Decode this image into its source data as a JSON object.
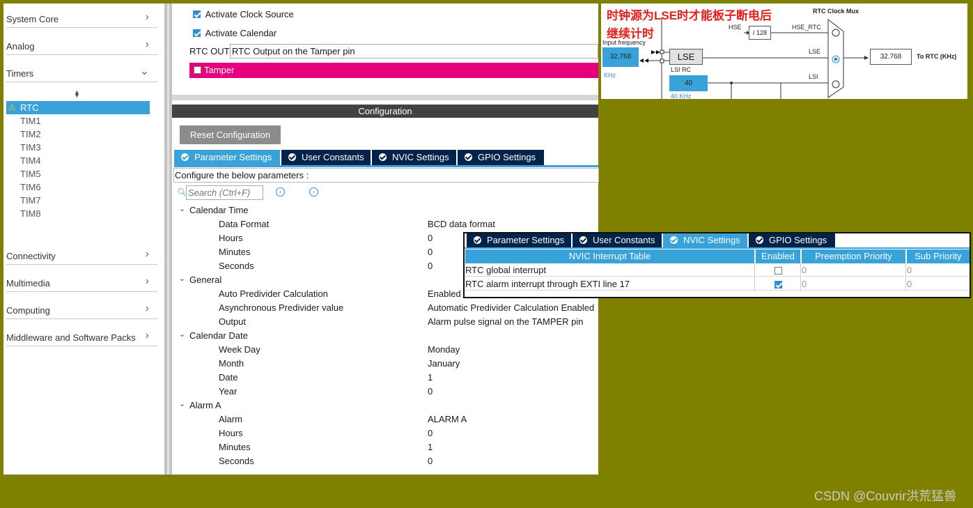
{
  "sidebar": {
    "categories": [
      {
        "label": "System Core",
        "expanded": false
      },
      {
        "label": "Analog",
        "expanded": false
      },
      {
        "label": "Timers",
        "expanded": true
      },
      {
        "label": "Connectivity",
        "expanded": false
      },
      {
        "label": "Multimedia",
        "expanded": false
      },
      {
        "label": "Computing",
        "expanded": false
      },
      {
        "label": "Middleware and Software Packs",
        "expanded": false
      }
    ],
    "timers": [
      "RTC",
      "TIM1",
      "TIM2",
      "TIM3",
      "TIM4",
      "TIM5",
      "TIM6",
      "TIM7",
      "TIM8"
    ],
    "selected": "RTC",
    "warning_icon": "warning-icon"
  },
  "mode": {
    "activate_clock_source": {
      "label": "Activate Clock Source",
      "checked": true
    },
    "activate_calendar": {
      "label": "Activate Calendar",
      "checked": true
    },
    "rtc_out_label": "RTC OUT",
    "rtc_out_value": "RTC Output on the Tamper pin",
    "tamper": {
      "label": "Tamper",
      "checked": false
    }
  },
  "config": {
    "title": "Configuration",
    "reset_label": "Reset Configuration",
    "tabs": [
      "Parameter Settings",
      "User Constants",
      "NVIC Settings",
      "GPIO Settings"
    ],
    "active_tab": "Parameter Settings",
    "hint": "Configure the below parameters :",
    "search_placeholder": "Search (Ctrl+F)",
    "groups": [
      {
        "name": "Calendar Time",
        "params": [
          {
            "key": "Data Format",
            "value": "BCD data format"
          },
          {
            "key": "Hours",
            "value": "0"
          },
          {
            "key": "Minutes",
            "value": "0"
          },
          {
            "key": "Seconds",
            "value": "0"
          }
        ]
      },
      {
        "name": "General",
        "params": [
          {
            "key": "Auto Predivider Calculation",
            "value": "Enabled"
          },
          {
            "key": "Asynchronous Predivider value",
            "value": "Automatic Predivider Calculation Enabled"
          },
          {
            "key": "Output",
            "value": "Alarm pulse signal on the TAMPER pin"
          }
        ]
      },
      {
        "name": "Calendar Date",
        "params": [
          {
            "key": "Week Day",
            "value": "Monday"
          },
          {
            "key": "Month",
            "value": "January"
          },
          {
            "key": "Date",
            "value": "1"
          },
          {
            "key": "Year",
            "value": "0"
          }
        ]
      },
      {
        "name": "Alarm A",
        "params": [
          {
            "key": "Alarm",
            "value": "ALARM A"
          },
          {
            "key": "Hours",
            "value": "0"
          },
          {
            "key": "Minutes",
            "value": "1"
          },
          {
            "key": "Seconds",
            "value": "0"
          }
        ]
      }
    ]
  },
  "nvic": {
    "tabs": [
      "Parameter Settings",
      "User Constants",
      "NVIC Settings",
      "GPIO Settings"
    ],
    "active_tab": "NVIC Settings",
    "headers": [
      "NVIC Interrupt Table",
      "Enabled",
      "Preemption Priority",
      "Sub Priority"
    ],
    "rows": [
      {
        "name": "RTC global interrupt",
        "enabled": false,
        "preemption": "0",
        "sub": "0"
      },
      {
        "name": "RTC alarm interrupt through EXTI line 17",
        "enabled": true,
        "preemption": "0",
        "sub": "0"
      }
    ]
  },
  "clock": {
    "annotation_line1": "时钟源为LSE时才能板子断电后",
    "annotation_line2": "继续计时",
    "mux_title": "RTC Clock Mux",
    "hse": "HSE",
    "div": "/ 128",
    "hse_rtc": "HSE_RTC",
    "input_freq_label": "Input frequency",
    "input_freq": "32.768",
    "khz_unit": "KHz",
    "lse": "LSE",
    "lse_line": "LSE",
    "lsi_rc": "LSI RC",
    "lsi_value": "40",
    "lsi_unit": "40 KHz",
    "lsi_line": "LSI",
    "out_value": "32.768",
    "out_label": "To RTC (KHz)",
    "selected_input": "LSE"
  },
  "watermark": "CSDN @Couvrir洪荒猛兽"
}
